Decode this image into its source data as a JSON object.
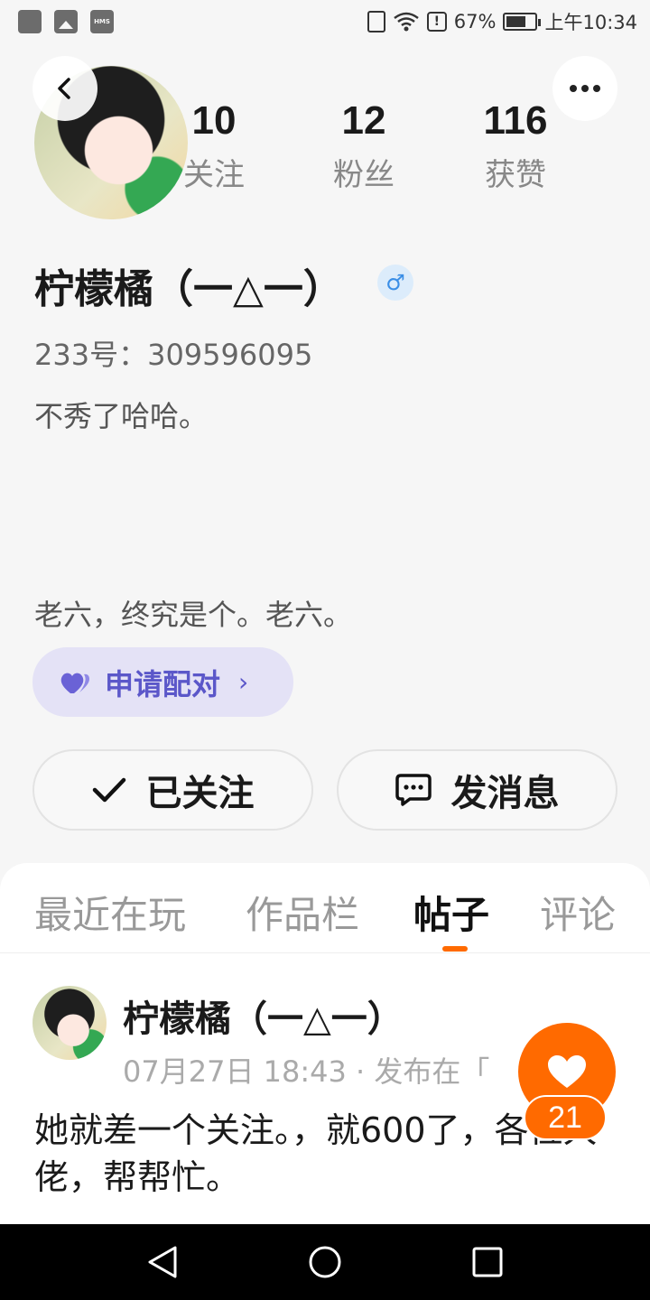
{
  "status_bar": {
    "hms_label": "HMS",
    "alert_glyph": "!",
    "battery": "67%",
    "time": "上午10:34"
  },
  "header": {
    "back_icon": "chevron-left-icon",
    "more_icon": "more-dots-icon"
  },
  "stats": [
    {
      "value": "10",
      "label": "关注"
    },
    {
      "value": "12",
      "label": "粉丝"
    },
    {
      "value": "116",
      "label": "获赞"
    }
  ],
  "profile": {
    "nickname": "柠檬橘（一△一）",
    "gender_symbol": "♂",
    "uid": "233号：309596095",
    "bio": "不秀了哈哈。",
    "motto": "老六，终究是个。老六。"
  },
  "pair": {
    "label": "申请配对",
    "chevron": "›"
  },
  "actions": {
    "follow_label": "已关注",
    "message_label": "发消息"
  },
  "tabs": [
    {
      "label": "最近在玩",
      "active": false
    },
    {
      "label": "作品栏",
      "active": false
    },
    {
      "label": "帖子",
      "active": true
    },
    {
      "label": "评论",
      "active": false
    }
  ],
  "post": {
    "author": "柠檬橘（一△一）",
    "meta": "07月27日 18:43 · 发布在「",
    "body": "她就差一个关注。，就600了，各位大佬，帮帮忙。"
  },
  "like": {
    "count": "21"
  },
  "colors": {
    "accent": "#ff6a00",
    "pair_bg": "#e4e2f6",
    "pair_text": "#5b57c9",
    "gender_blue": "#3a8ee6"
  }
}
